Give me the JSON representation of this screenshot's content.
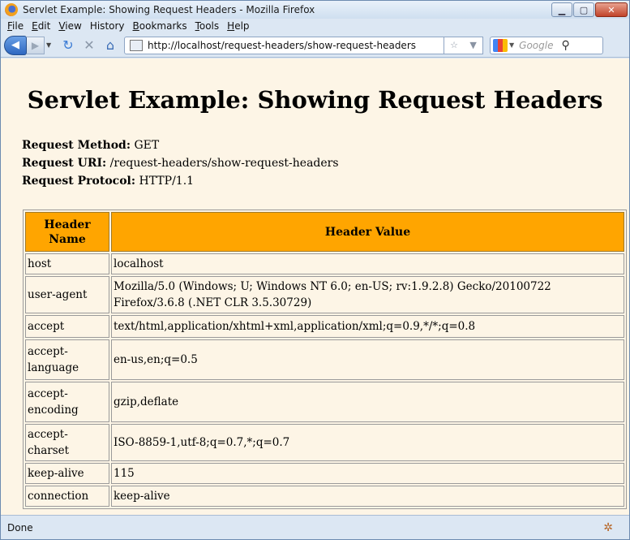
{
  "window": {
    "title": "Servlet Example: Showing Request Headers - Mozilla Firefox"
  },
  "menu": {
    "items": [
      {
        "underline": "F",
        "rest": "ile"
      },
      {
        "underline": "E",
        "rest": "dit"
      },
      {
        "underline": "V",
        "rest": "iew"
      },
      {
        "underline": "",
        "rest": "History"
      },
      {
        "underline": "B",
        "rest": "ookmarks"
      },
      {
        "underline": "T",
        "rest": "ools"
      },
      {
        "underline": "H",
        "rest": "elp"
      }
    ]
  },
  "nav": {
    "url": "http://localhost/request-headers/show-request-headers",
    "search_placeholder": "Google"
  },
  "page": {
    "title": "Servlet Example: Showing Request Headers",
    "method_label": "Request Method:",
    "method_value": "GET",
    "uri_label": "Request URI:",
    "uri_value": "/request-headers/show-request-headers",
    "protocol_label": "Request Protocol:",
    "protocol_value": "HTTP/1.1"
  },
  "table": {
    "col_name": "Header Name",
    "col_value": "Header Value",
    "rows": [
      {
        "name": "host",
        "value": "localhost"
      },
      {
        "name": "user-agent",
        "value": "Mozilla/5.0 (Windows; U; Windows NT 6.0; en-US; rv:1.9.2.8) Gecko/20100722 Firefox/3.6.8 (.NET CLR 3.5.30729)"
      },
      {
        "name": "accept",
        "value": "text/html,application/xhtml+xml,application/xml;q=0.9,*/*;q=0.8"
      },
      {
        "name": "accept-language",
        "value": "en-us,en;q=0.5"
      },
      {
        "name": "accept-encoding",
        "value": "gzip,deflate"
      },
      {
        "name": "accept-charset",
        "value": "ISO-8859-1,utf-8;q=0.7,*;q=0.7"
      },
      {
        "name": "keep-alive",
        "value": "115"
      },
      {
        "name": "connection",
        "value": "keep-alive"
      }
    ]
  },
  "status": {
    "text": "Done"
  },
  "colors": {
    "page_bg": "#fdf5e6",
    "header_bg": "#ffa500"
  }
}
